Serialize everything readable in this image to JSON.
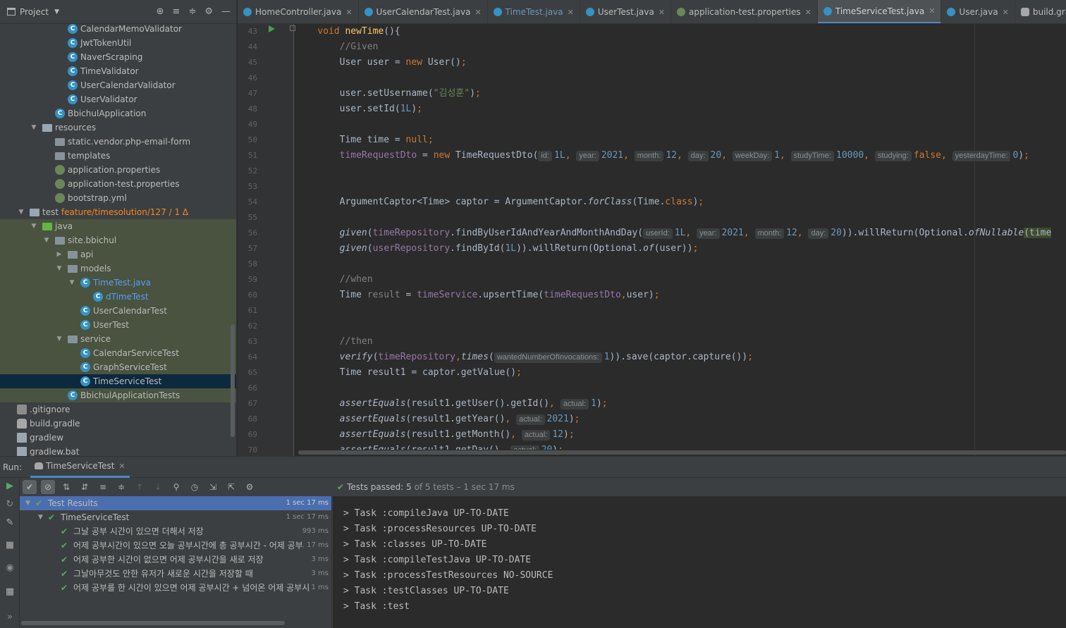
{
  "project": {
    "title": "Project",
    "tree": [
      {
        "label": "CalendarMemoValidator",
        "icon": "class",
        "indent": 2
      },
      {
        "label": "JwtTokenUtil",
        "icon": "class",
        "indent": 2
      },
      {
        "label": "NaverScraping",
        "icon": "class",
        "indent": 2
      },
      {
        "label": "TimeValidator",
        "icon": "class",
        "indent": 2
      },
      {
        "label": "UserCalendarValidator",
        "icon": "class",
        "indent": 2
      },
      {
        "label": "UserValidator",
        "icon": "class",
        "indent": 2
      },
      {
        "label": "BbichulApplication",
        "icon": "app",
        "indent": 1
      },
      {
        "label": "resources",
        "icon": "folder-res",
        "indent": 0,
        "arrow": "down"
      },
      {
        "label": "static.vendor.php-email-form",
        "icon": "folder",
        "indent": 1
      },
      {
        "label": "templates",
        "icon": "folder",
        "indent": 1
      },
      {
        "label": "application.properties",
        "icon": "prop",
        "indent": 1
      },
      {
        "label": "application-test.properties",
        "icon": "prop",
        "indent": 1
      },
      {
        "label": "bootstrap.yml",
        "icon": "yml",
        "indent": 1
      },
      {
        "label": "test",
        "icon": "folder-test",
        "indent": -1,
        "arrow": "down",
        "branch": "feature/timesolution/127",
        "delta": "/ 1 Δ"
      },
      {
        "label": "java",
        "icon": "folder-green",
        "indent": 0,
        "arrow": "down",
        "green": true
      },
      {
        "label": "site.bbichul",
        "icon": "folder",
        "indent": 1,
        "arrow": "down",
        "green": true
      },
      {
        "label": "api",
        "icon": "folder",
        "indent": 2,
        "arrow": "right",
        "green": true
      },
      {
        "label": "models",
        "icon": "folder",
        "indent": 2,
        "arrow": "down",
        "green": true
      },
      {
        "label": "TimeTest.java",
        "icon": "class",
        "indent": 3,
        "arrow": "down",
        "green": true,
        "color": "blue"
      },
      {
        "label": "dTimeTest",
        "icon": "class",
        "indent": 4,
        "green": true,
        "color": "blue"
      },
      {
        "label": "UserCalendarTest",
        "icon": "class",
        "indent": 3,
        "green": true
      },
      {
        "label": "UserTest",
        "icon": "class",
        "indent": 3,
        "green": true
      },
      {
        "label": "service",
        "icon": "folder",
        "indent": 2,
        "arrow": "down",
        "green": true
      },
      {
        "label": "CalendarServiceTest",
        "icon": "class",
        "indent": 3,
        "green": true
      },
      {
        "label": "GraphServiceTest",
        "icon": "class",
        "indent": 3,
        "green": true
      },
      {
        "label": "TimeServiceTest",
        "icon": "class",
        "indent": 3,
        "selected": true
      },
      {
        "label": "BbichulApplicationTests",
        "icon": "app",
        "indent": 2,
        "green": true
      },
      {
        "label": ".gitignore",
        "icon": "git",
        "indent": -2
      },
      {
        "label": "build.gradle",
        "icon": "gradle",
        "indent": -2
      },
      {
        "label": "gradlew",
        "icon": "file",
        "indent": -2
      },
      {
        "label": "gradlew.bat",
        "icon": "file",
        "indent": -2
      }
    ]
  },
  "tabs": [
    {
      "label": "HomeController.java",
      "icon": "class"
    },
    {
      "label": "UserCalendarTest.java",
      "icon": "class"
    },
    {
      "label": "TimeTest.java",
      "icon": "class",
      "modified": true
    },
    {
      "label": "UserTest.java",
      "icon": "class"
    },
    {
      "label": "application-test.properties",
      "icon": "prop"
    },
    {
      "label": "TimeServiceTest.java",
      "icon": "class",
      "active": true
    },
    {
      "label": "User.java",
      "icon": "class"
    },
    {
      "label": "build.gradle (bbichul)",
      "icon": "gradle"
    }
  ],
  "editor": {
    "line_numbers": [
      "43",
      "44",
      "45",
      "46",
      "47",
      "48",
      "49",
      "50",
      "51",
      "52",
      "53",
      "54",
      "55",
      "56",
      "57",
      "58",
      "59",
      "60",
      "61",
      "62",
      "63",
      "64",
      "65",
      "66",
      "67",
      "68",
      "69",
      "70"
    ],
    "hints": {
      "id": "id:",
      "year": "year:",
      "month": "month:",
      "day": "day:",
      "weekDay": "weekDay:",
      "studyTime": "studyTime:",
      "studying": "studying:",
      "yesterdayTime": "yesterdayTime:",
      "userId": "userId:",
      "wanted": "wantedNumberOfInvocations:",
      "actual": "actual:"
    },
    "strings": {
      "username": "\"김성훈\""
    }
  },
  "run": {
    "label": "Run:",
    "tab": "TimeServiceTest",
    "status": {
      "passed": "Tests passed: 5",
      "rest": "of 5 tests – 1 sec 17 ms"
    },
    "results": [
      {
        "label": "Test Results",
        "dur": "1 sec 17 ms",
        "indent": 0,
        "arrow": true,
        "selected": true
      },
      {
        "label": "TimeServiceTest",
        "dur": "1 sec 17 ms",
        "indent": 1,
        "arrow": true
      },
      {
        "label": "그날 공부 시간이 있으면 더해서 저장",
        "dur": "993 ms",
        "indent": 2
      },
      {
        "label": "어제 공부시간이 있으면 오늘 공부시간에 총 공부시간 - 어제 공부시간",
        "dur": "17 ms",
        "indent": 2
      },
      {
        "label": "어제 공부한 시간이 없으면 어제 공부시간을 새로 저장",
        "dur": "3 ms",
        "indent": 2
      },
      {
        "label": "그날아무것도 안한 유저가 새로운 시간을 저장할 때",
        "dur": "3 ms",
        "indent": 2
      },
      {
        "label": "어제 공부를 한 시간이 있으면 어제 공부시간 + 넘어온 어제 공부시간",
        "dur": "1 ms",
        "indent": 2
      }
    ],
    "console": [
      "> Task :compileJava UP-TO-DATE",
      "> Task :processResources UP-TO-DATE",
      "> Task :classes UP-TO-DATE",
      "> Task :compileTestJava UP-TO-DATE",
      "> Task :processTestResources NO-SOURCE",
      "> Task :testClasses UP-TO-DATE",
      "> Task :test"
    ]
  },
  "colors": {
    "accent": "#4a88c7",
    "pass": "#59a869",
    "selection": "#4b6eaf"
  }
}
